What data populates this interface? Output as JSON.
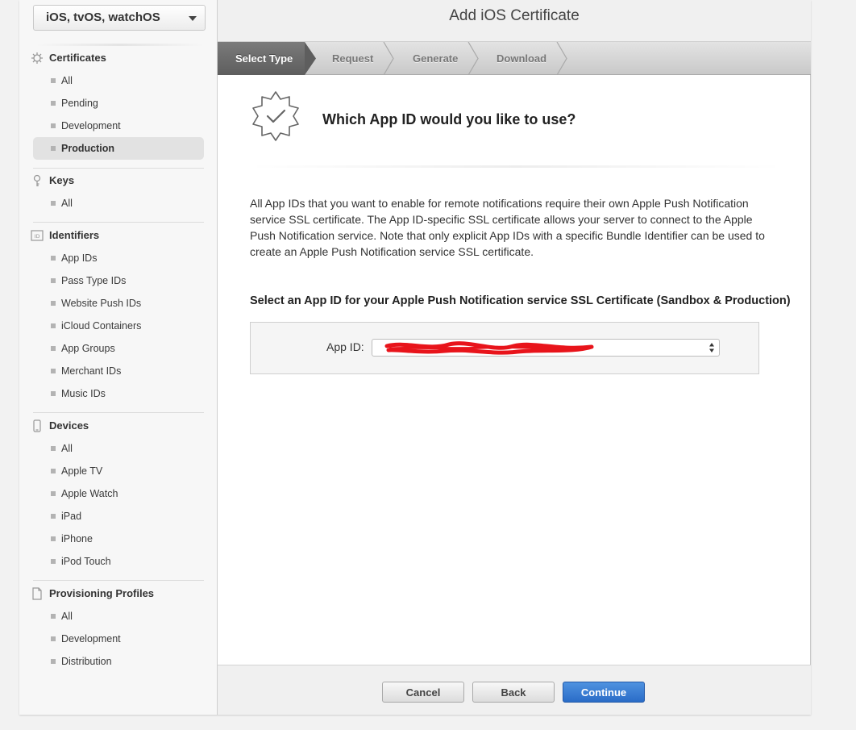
{
  "platform_selector": {
    "value": "iOS, tvOS, watchOS"
  },
  "sidebar": {
    "certificates": {
      "title": "Certificates",
      "icon": "gear-icon",
      "items": [
        "All",
        "Pending",
        "Development",
        "Production"
      ],
      "active": "Production"
    },
    "keys": {
      "title": "Keys",
      "icon": "key-icon",
      "items": [
        "All"
      ]
    },
    "identifiers": {
      "title": "Identifiers",
      "icon": "id-icon",
      "items": [
        "App IDs",
        "Pass Type IDs",
        "Website Push IDs",
        "iCloud Containers",
        "App Groups",
        "Merchant IDs",
        "Music IDs"
      ]
    },
    "devices": {
      "title": "Devices",
      "icon": "device-icon",
      "items": [
        "All",
        "Apple TV",
        "Apple Watch",
        "iPad",
        "iPhone",
        "iPod Touch"
      ]
    },
    "profiles": {
      "title": "Provisioning Profiles",
      "icon": "document-icon",
      "items": [
        "All",
        "Development",
        "Distribution"
      ]
    }
  },
  "page": {
    "title": "Add iOS Certificate",
    "steps": [
      "Select Type",
      "Request",
      "Generate",
      "Download"
    ],
    "active_step": "Select Type"
  },
  "content": {
    "question": "Which App ID would you like to use?",
    "description": "All App IDs that you want to enable for remote notifications require their own Apple Push Notification service SSL certificate. The App ID-specific SSL certificate allows your server to connect to the Apple Push Notification service. Note that only explicit App IDs with a specific Bundle Identifier can be used to create an Apple Push Notification service SSL certificate.",
    "select_title": "Select an App ID for your Apple Push Notification service SSL Certificate (Sandbox & Production)",
    "app_id_label": "App ID:"
  },
  "footer": {
    "cancel": "Cancel",
    "back": "Back",
    "continue": "Continue"
  },
  "colors": {
    "primary_button": "#2a6cc7",
    "redaction": "#e8141b",
    "active_step": "#6a6a6a"
  }
}
